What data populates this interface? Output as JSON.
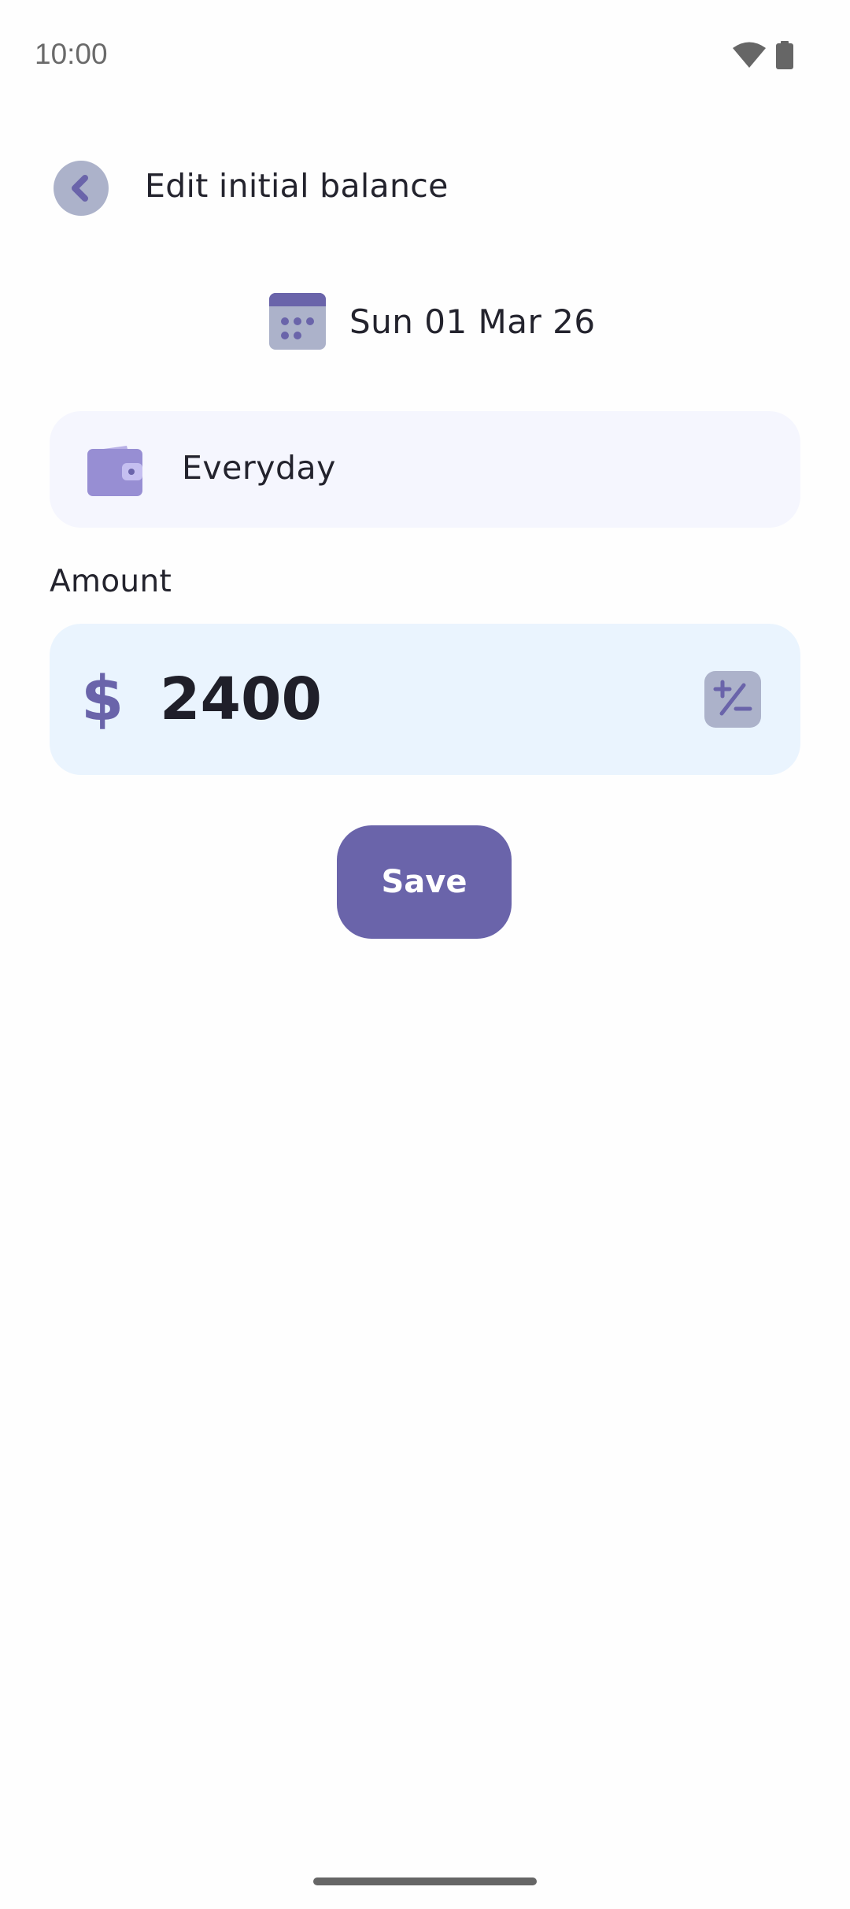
{
  "status_bar": {
    "time": "10:00",
    "icons": [
      "wifi-icon",
      "battery-icon"
    ]
  },
  "header": {
    "back_icon": "chevron-left-icon",
    "title": "Edit initial balance"
  },
  "date": {
    "icon": "calendar-icon",
    "label": "Sun 01 Mar 26"
  },
  "account": {
    "icon": "wallet-icon",
    "name": "Everyday"
  },
  "amount": {
    "label": "Amount",
    "currency_symbol": "$",
    "value": "2400",
    "sign_toggle_icon": "plus-minus-icon"
  },
  "actions": {
    "save_label": "Save"
  },
  "colors": {
    "accent": "#6a64aa",
    "icon_bg": "#acb2ca",
    "card_bg": "#f5f6fe",
    "amount_bg": "#eaf4fe",
    "wallet": "#978ed3"
  }
}
